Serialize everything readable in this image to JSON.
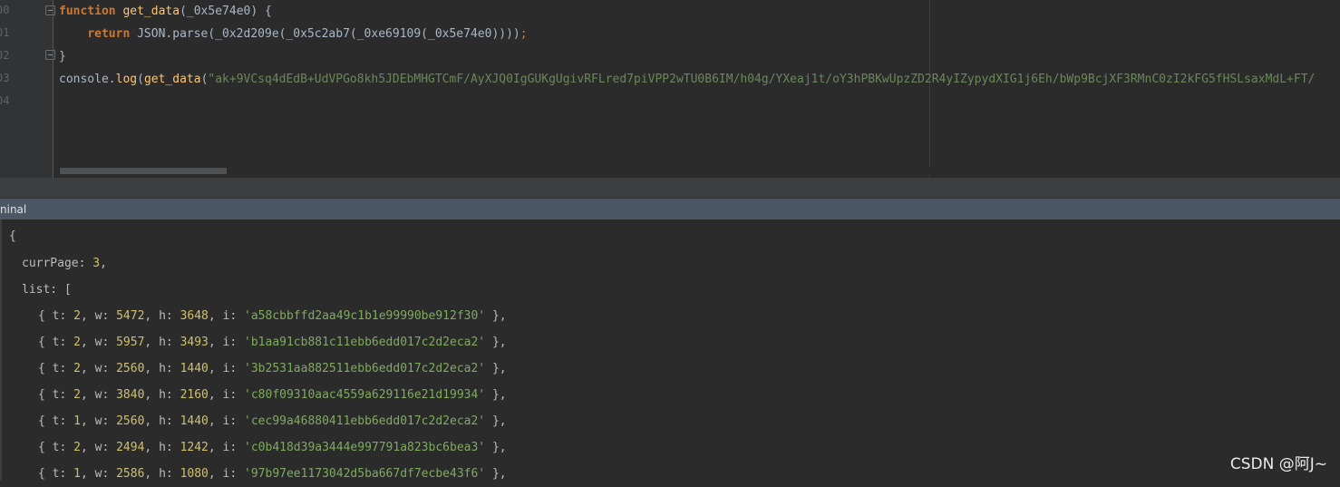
{
  "editor": {
    "line_numbers": [
      "00",
      "01",
      "02",
      "03",
      "04"
    ],
    "line1": {
      "kw_function": "function",
      "fn_name": "get_data",
      "params": "(_0x5e74e0) {"
    },
    "line2": {
      "indent": "    ",
      "kw_return": "return",
      "call": " JSON.parse(_0x2d209e(_0x5c2ab7(_0xe69109(_0x5e74e0))))",
      "semi": ";"
    },
    "line3": {
      "text": "}"
    },
    "line4": {
      "prefix": "console.",
      "log": "log",
      "open": "(",
      "fn": "get_data",
      "open2": "(",
      "string": "\"ak+9VCsq4dEdB+UdVPGo8kh5JDEbMHGTCmF/AyXJQ0IgGUKgUgivRFLred7piVPP2wTU0B6IM/h04g/YXeaj1t/oY3hPBKwUpzZD2R4yIZypydXIG1j6Eh/bWp9BcjXF3RMnC0zI2kFG5fHSLsaxMdL+FT/"
    }
  },
  "terminal": {
    "title": "ninal",
    "lines": {
      "open_brace": "{",
      "currPage_key": "currPage: ",
      "currPage_val": "3",
      "comma": ",",
      "list_key": "list: ["
    },
    "rows": [
      {
        "t": "2",
        "w": "5472",
        "h": "3648",
        "i": "'a58cbbffd2aa49c1b1e99990be912f30'"
      },
      {
        "t": "2",
        "w": "5957",
        "h": "3493",
        "i": "'b1aa91cb881c11ebb6edd017c2d2eca2'"
      },
      {
        "t": "2",
        "w": "2560",
        "h": "1440",
        "i": "'3b2531aa882511ebb6edd017c2d2eca2'"
      },
      {
        "t": "2",
        "w": "3840",
        "h": "2160",
        "i": "'c80f09310aac4559a629116e21d19934'"
      },
      {
        "t": "1",
        "w": "2560",
        "h": "1440",
        "i": "'cec99a46880411ebb6edd017c2d2eca2'"
      },
      {
        "t": "2",
        "w": "2494",
        "h": "1242",
        "i": "'c0b418d39a3444e997791a823bc6bea3'"
      },
      {
        "t": "1",
        "w": "2586",
        "h": "1080",
        "i": "'97b97ee1173042d5ba667df7ecbe43f6'"
      }
    ]
  },
  "watermark": "CSDN @阿J~",
  "colors": {
    "keyword": "#cc7832",
    "function": "#ffc66d",
    "string": "#6a8759",
    "number": "#d0c06a",
    "background": "#2b2b2b",
    "terminal_header": "#4b5765"
  }
}
